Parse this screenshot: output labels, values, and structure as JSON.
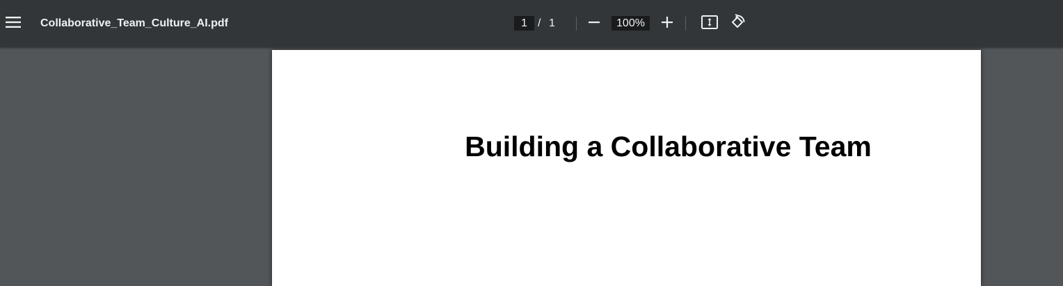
{
  "toolbar": {
    "filename": "Collaborative_Team_Culture_AI.pdf",
    "current_page": "1",
    "page_separator": "/",
    "total_pages": "1",
    "zoom": "100%",
    "icons": {
      "menu": "menu-icon",
      "zoom_out": "minus-icon",
      "zoom_in": "plus-icon",
      "fit": "fit-to-page-icon",
      "rotate": "rotate-icon"
    }
  },
  "document": {
    "title": "Building a Collaborative Team"
  },
  "colors": {
    "toolbar_bg": "#323639",
    "viewer_bg": "#525659",
    "page_bg": "#ffffff",
    "toolbar_text": "#f1f1f1"
  }
}
